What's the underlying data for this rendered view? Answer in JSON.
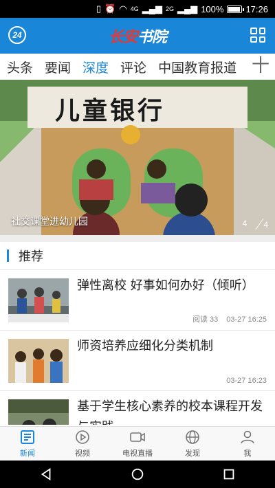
{
  "status_bar": {
    "network": "4G",
    "network2": "2G",
    "battery": "100%",
    "time": "17:26"
  },
  "header": {
    "left_badge": "24",
    "logo_part1": "长安",
    "logo_part2": "书院",
    "menu_icon": "grid-icon"
  },
  "tabs": [
    {
      "label": "头条",
      "active": false
    },
    {
      "label": "要闻",
      "active": false
    },
    {
      "label": "深度",
      "active": true
    },
    {
      "label": "评论",
      "active": false
    },
    {
      "label": "中国教育报道",
      "active": false
    }
  ],
  "tabs_more": "十",
  "hero": {
    "caption": "社交课堂进幼儿园",
    "index": "4",
    "total": "4",
    "sign_text": "儿童银行"
  },
  "section": {
    "title": "推荐"
  },
  "news": [
    {
      "title": "弹性离校 好事如何办好（倾听）",
      "reads": "阅读 33",
      "time": "03-27 16:25"
    },
    {
      "title": "师资培养应细化分类机制",
      "reads": "",
      "time": "03-27 16:23"
    },
    {
      "title": "基于学生核心素养的校本课程开发与实践",
      "reads": "",
      "time": ""
    }
  ],
  "bottom_nav": [
    {
      "label": "新闻",
      "icon": "news-icon",
      "active": true
    },
    {
      "label": "视频",
      "icon": "play-icon",
      "active": false
    },
    {
      "label": "电视直播",
      "icon": "tv-icon",
      "active": false
    },
    {
      "label": "发现",
      "icon": "globe-icon",
      "active": false
    },
    {
      "label": "我",
      "icon": "user-icon",
      "active": false
    }
  ],
  "colors": {
    "brand_blue": "#1a86d8",
    "logo_red": "#e53935"
  }
}
